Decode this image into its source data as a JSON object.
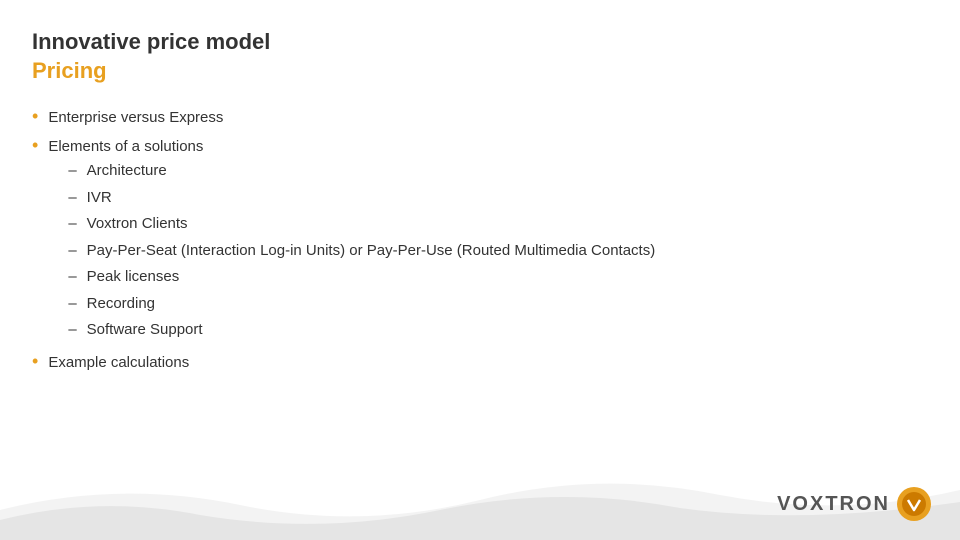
{
  "header": {
    "title_main": "Innovative price model",
    "title_sub": "Pricing"
  },
  "content": {
    "bullet1": {
      "text": "Enterprise versus Express"
    },
    "bullet2": {
      "text": "Elements of a solutions",
      "subitems": [
        "Architecture",
        "IVR",
        "Voxtron Clients",
        "Pay-Per-Seat (Interaction Log-in Units) or Pay-Per-Use (Routed Multimedia Contacts)",
        "Peak licenses",
        "Recording",
        "Software Support"
      ]
    },
    "bullet3": {
      "text": "Example calculations"
    }
  },
  "logo": {
    "text": "VOXTRON"
  },
  "colors": {
    "accent": "#E8A020",
    "text": "#333333",
    "logo_circle_outer": "#E8A020",
    "logo_circle_inner": "#cc7a00"
  }
}
